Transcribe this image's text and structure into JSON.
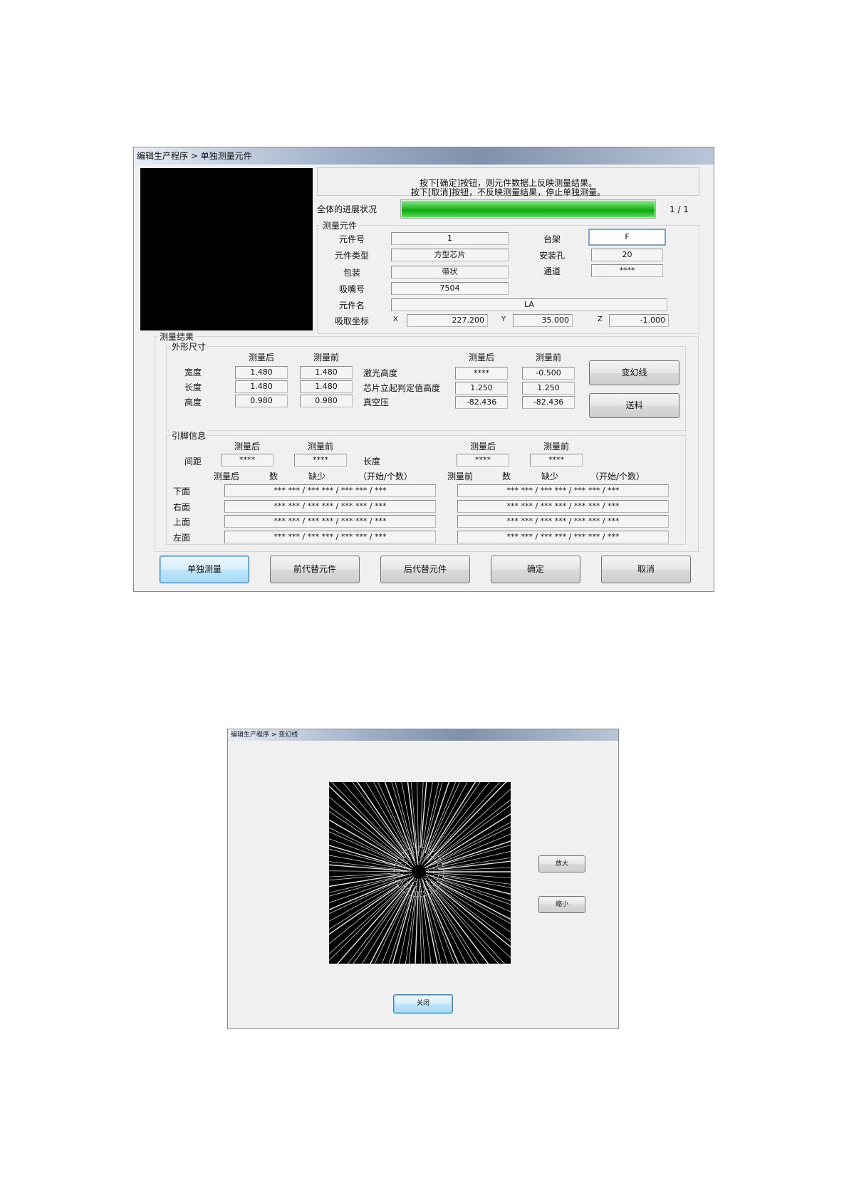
{
  "win1": {
    "title": "编辑生产程序 > 单独测量元件",
    "instruction_line1": "按下[确定]按钮，则元件数据上反映测量结果。",
    "instruction_line2": "按下[取消]按钮，不反映测量结果，停止单独测量。",
    "progress": {
      "label": "全体的进展状况",
      "value": 1.0,
      "text": "1 / 1"
    },
    "component": {
      "group_title": "测量元件",
      "part_no_label": "元件号",
      "part_no": "1",
      "type_label": "元件类型",
      "type": "方型芯片",
      "package_label": "包装",
      "package": "带状",
      "nozzle_label": "吸嘴号",
      "nozzle": "7504",
      "name_label": "元件名",
      "name": "LA",
      "rack_label": "台架",
      "rack": "F",
      "hole_label": "安装孔",
      "hole": "20",
      "channel_label": "通道",
      "channel": "****",
      "pickup_label": "吸取坐标",
      "x_label": "X",
      "x": "227.200",
      "y_label": "Y",
      "y": "35.000",
      "z_label": "Z",
      "z": "-1.000"
    },
    "results": {
      "group_title": "测量结果",
      "shape": {
        "group_title": "外形尺寸",
        "after_label": "测量后",
        "before_label": "测量前",
        "rows": [
          {
            "label": "宽度",
            "after": "1.480",
            "before": "1.480"
          },
          {
            "label": "长度",
            "after": "1.480",
            "before": "1.480"
          },
          {
            "label": "高度",
            "after": "0.980",
            "before": "0.980"
          }
        ],
        "rows2": [
          {
            "label": "激光高度",
            "after": "****",
            "before": "-0.500"
          },
          {
            "label": "芯片立起判定值高度",
            "after": "1.250",
            "before": "1.250"
          },
          {
            "label": "真空压",
            "after": "-82.436",
            "before": "-82.436"
          }
        ]
      },
      "leads": {
        "group_title": "引脚信息",
        "after_label": "测量后",
        "before_label": "测量前",
        "pitch_label": "间距",
        "pitch_after": "****",
        "pitch_before": "****",
        "length_label": "长度",
        "length_after": "****",
        "length_before": "****",
        "hdr_after": "测量后",
        "hdr_count": "数",
        "hdr_missing": "缺少",
        "hdr_start": "（开始/个数）",
        "hdr_before": "测量前",
        "hdr_count2": "数",
        "hdr_missing2": "缺少",
        "hdr_start2": "（开始/个数）",
        "sides": [
          {
            "label": "下面",
            "after": "*** *** / *** *** / *** *** / ***",
            "before": "*** *** / *** *** / *** *** / ***"
          },
          {
            "label": "右面",
            "after": "*** *** / *** *** / *** *** / ***",
            "before": "*** *** / *** *** / *** *** / ***"
          },
          {
            "label": "上面",
            "after": "*** *** / *** *** / *** *** / ***",
            "before": "*** *** / *** *** / *** *** / ***"
          },
          {
            "label": "左面",
            "after": "*** *** / *** *** / *** *** / ***",
            "before": "*** *** / *** *** / *** *** / ***"
          }
        ]
      }
    },
    "btn_transform": "变幻线",
    "btn_feed": "送料",
    "buttons": {
      "single": "单独测量",
      "prev": "前代替元件",
      "next": "后代替元件",
      "ok": "确定",
      "cancel": "取消"
    }
  },
  "win2": {
    "title": "编辑生产程序 > 变幻线",
    "zoom_in": "放大",
    "zoom_out": "缩小",
    "close": "关闭"
  },
  "colors": {
    "progress": "#1bb51b",
    "focus": "#3c7fb1",
    "window": "#f0f0f0"
  }
}
